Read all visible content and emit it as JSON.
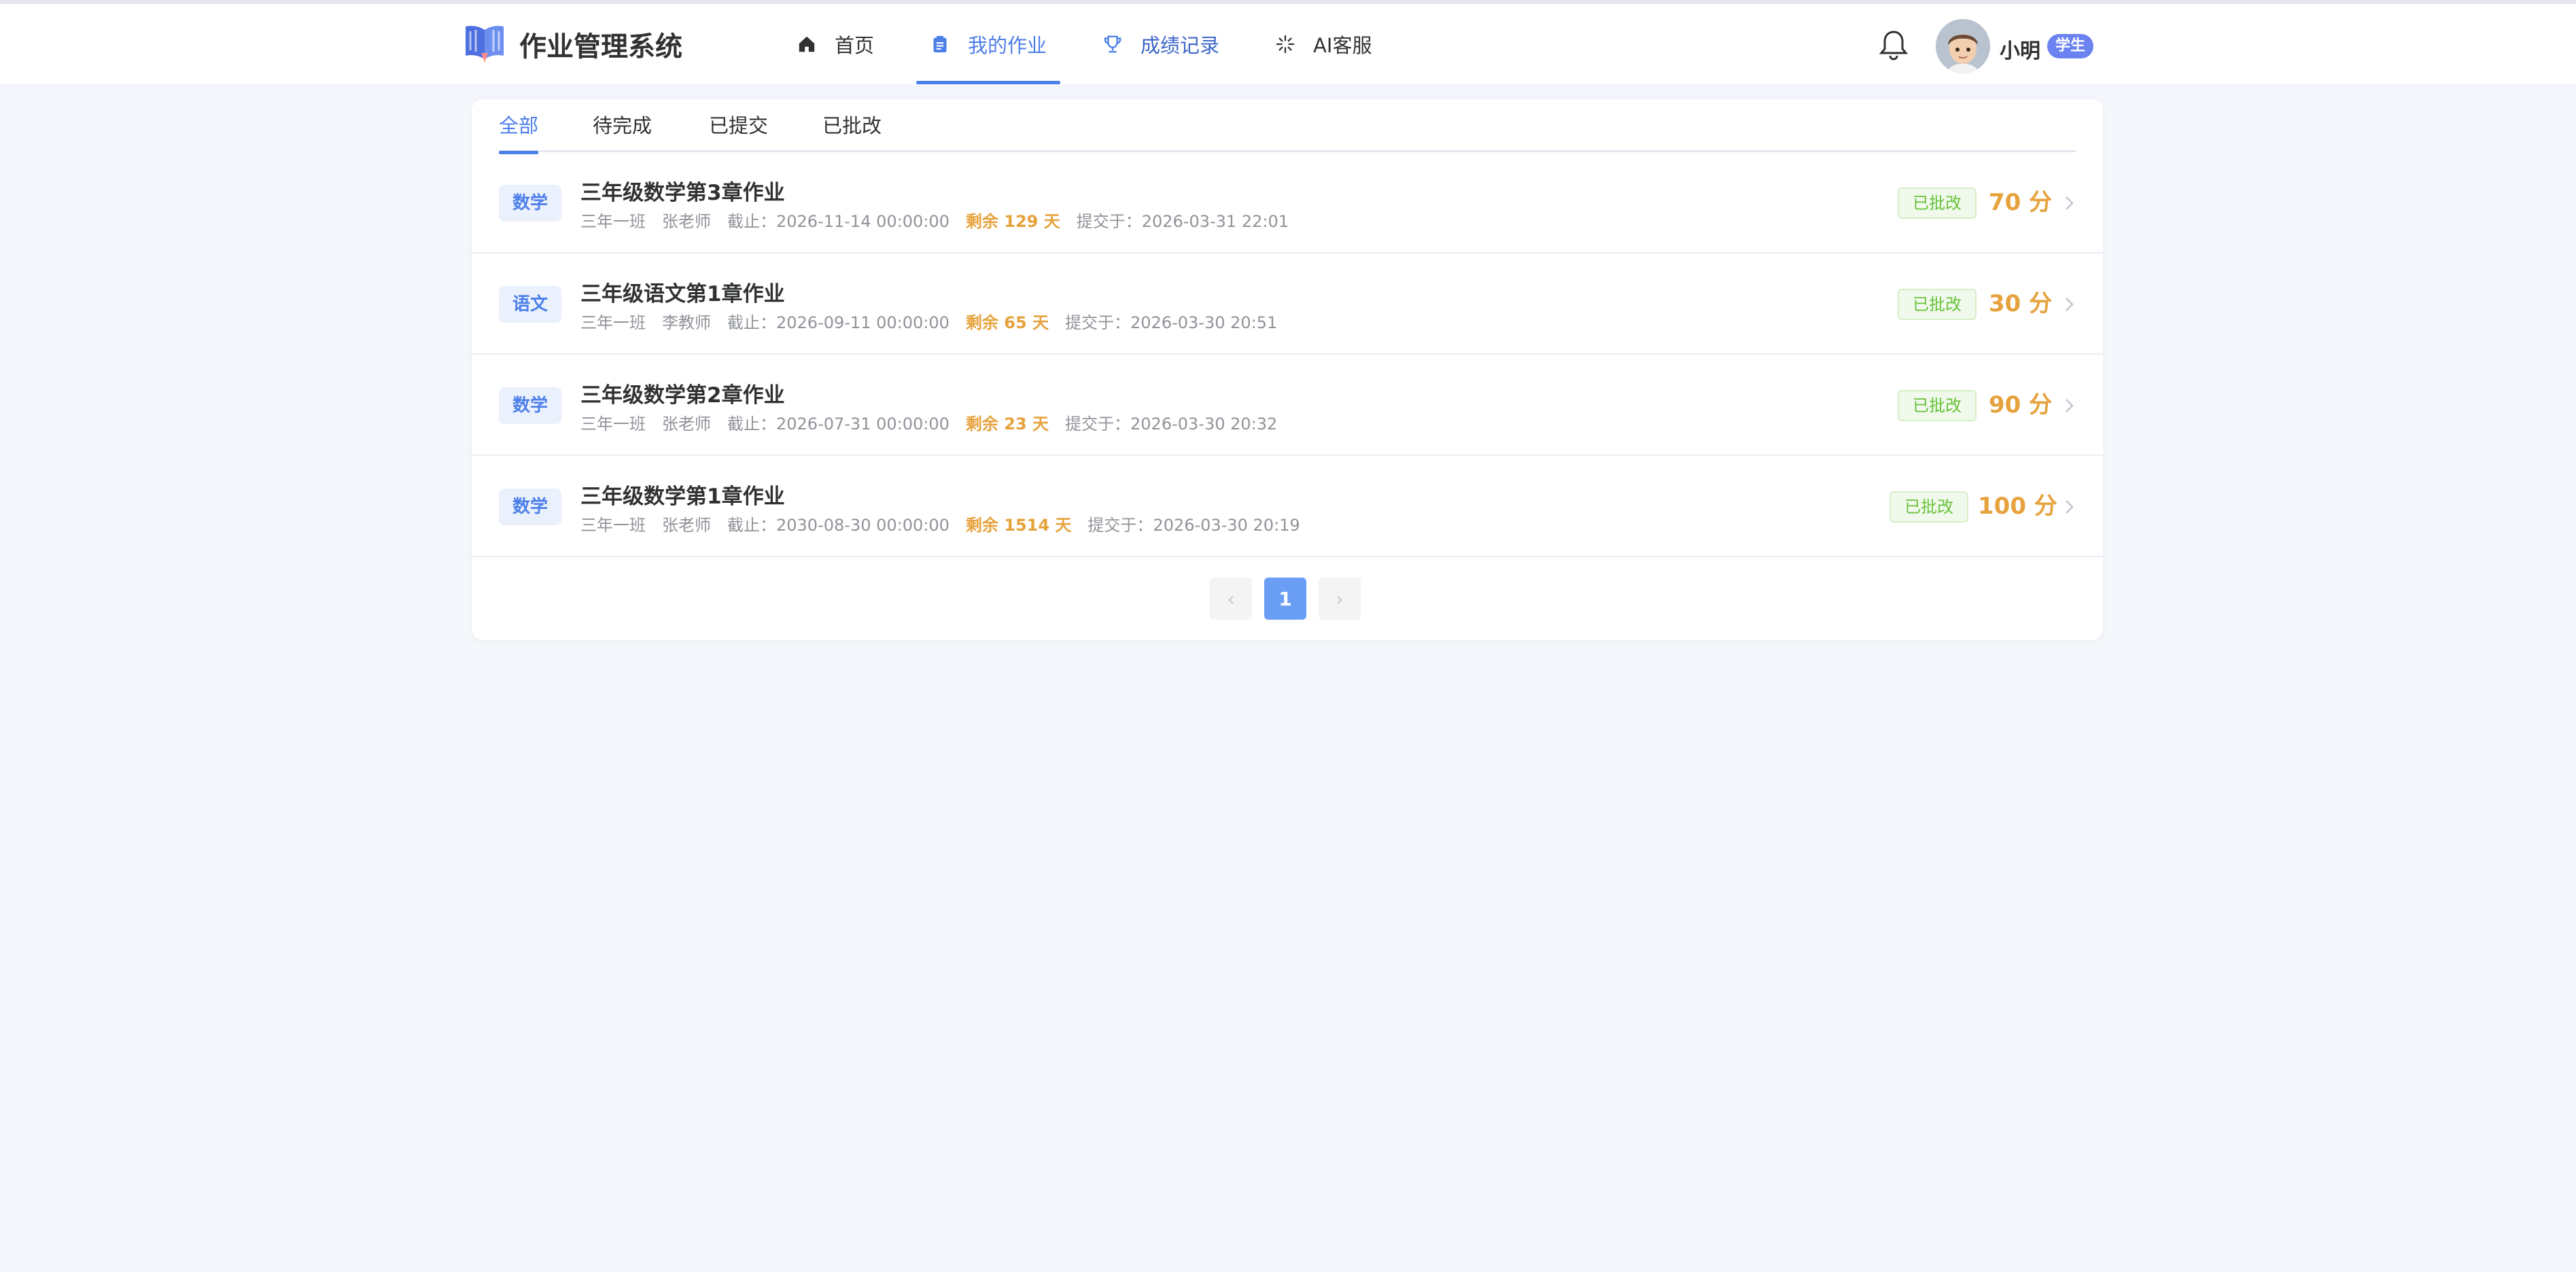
{
  "app": {
    "title": "作业管理系统"
  },
  "nav": {
    "items": [
      {
        "label": "首页",
        "icon": "home-icon"
      },
      {
        "label": "我的作业",
        "icon": "clipboard-icon",
        "active": true
      },
      {
        "label": "成绩记录",
        "icon": "trophy-icon"
      },
      {
        "label": "AI客服",
        "icon": "sparkle-icon"
      }
    ]
  },
  "user": {
    "name": "小明",
    "role": "学生"
  },
  "tabs": [
    {
      "label": "全部",
      "active": true
    },
    {
      "label": "待完成"
    },
    {
      "label": "已提交"
    },
    {
      "label": "已批改"
    }
  ],
  "assignments": [
    {
      "subject": "数学",
      "title": "三年级数学第3章作业",
      "class": "三年一班",
      "teacher": "张老师",
      "deadline": "截止：2026-11-14 00:00:00",
      "remaining": "剩余 129 天",
      "submitted": "提交于：2026-03-31 22:01",
      "status": "已批改",
      "score": "70 分"
    },
    {
      "subject": "语文",
      "title": "三年级语文第1章作业",
      "class": "三年一班",
      "teacher": "李教师",
      "deadline": "截止：2026-09-11 00:00:00",
      "remaining": "剩余 65 天",
      "submitted": "提交于：2026-03-30 20:51",
      "status": "已批改",
      "score": "30 分"
    },
    {
      "subject": "数学",
      "title": "三年级数学第2章作业",
      "class": "三年一班",
      "teacher": "张老师",
      "deadline": "截止：2026-07-31 00:00:00",
      "remaining": "剩余 23 天",
      "submitted": "提交于：2026-03-30 20:32",
      "status": "已批改",
      "score": "90 分"
    },
    {
      "subject": "数学",
      "title": "三年级数学第1章作业",
      "class": "三年一班",
      "teacher": "张老师",
      "deadline": "截止：2030-08-30 00:00:00",
      "remaining": "剩余 1514 天",
      "submitted": "提交于：2026-03-30 20:19",
      "status": "已批改",
      "score": "100 分"
    }
  ],
  "pagination": {
    "prev": "‹",
    "current": "1",
    "next": "›"
  },
  "colors": {
    "accent": "#4d7fe8",
    "warning": "#e6a23c",
    "success": "#67c23a",
    "background": "#f4f6fb"
  }
}
